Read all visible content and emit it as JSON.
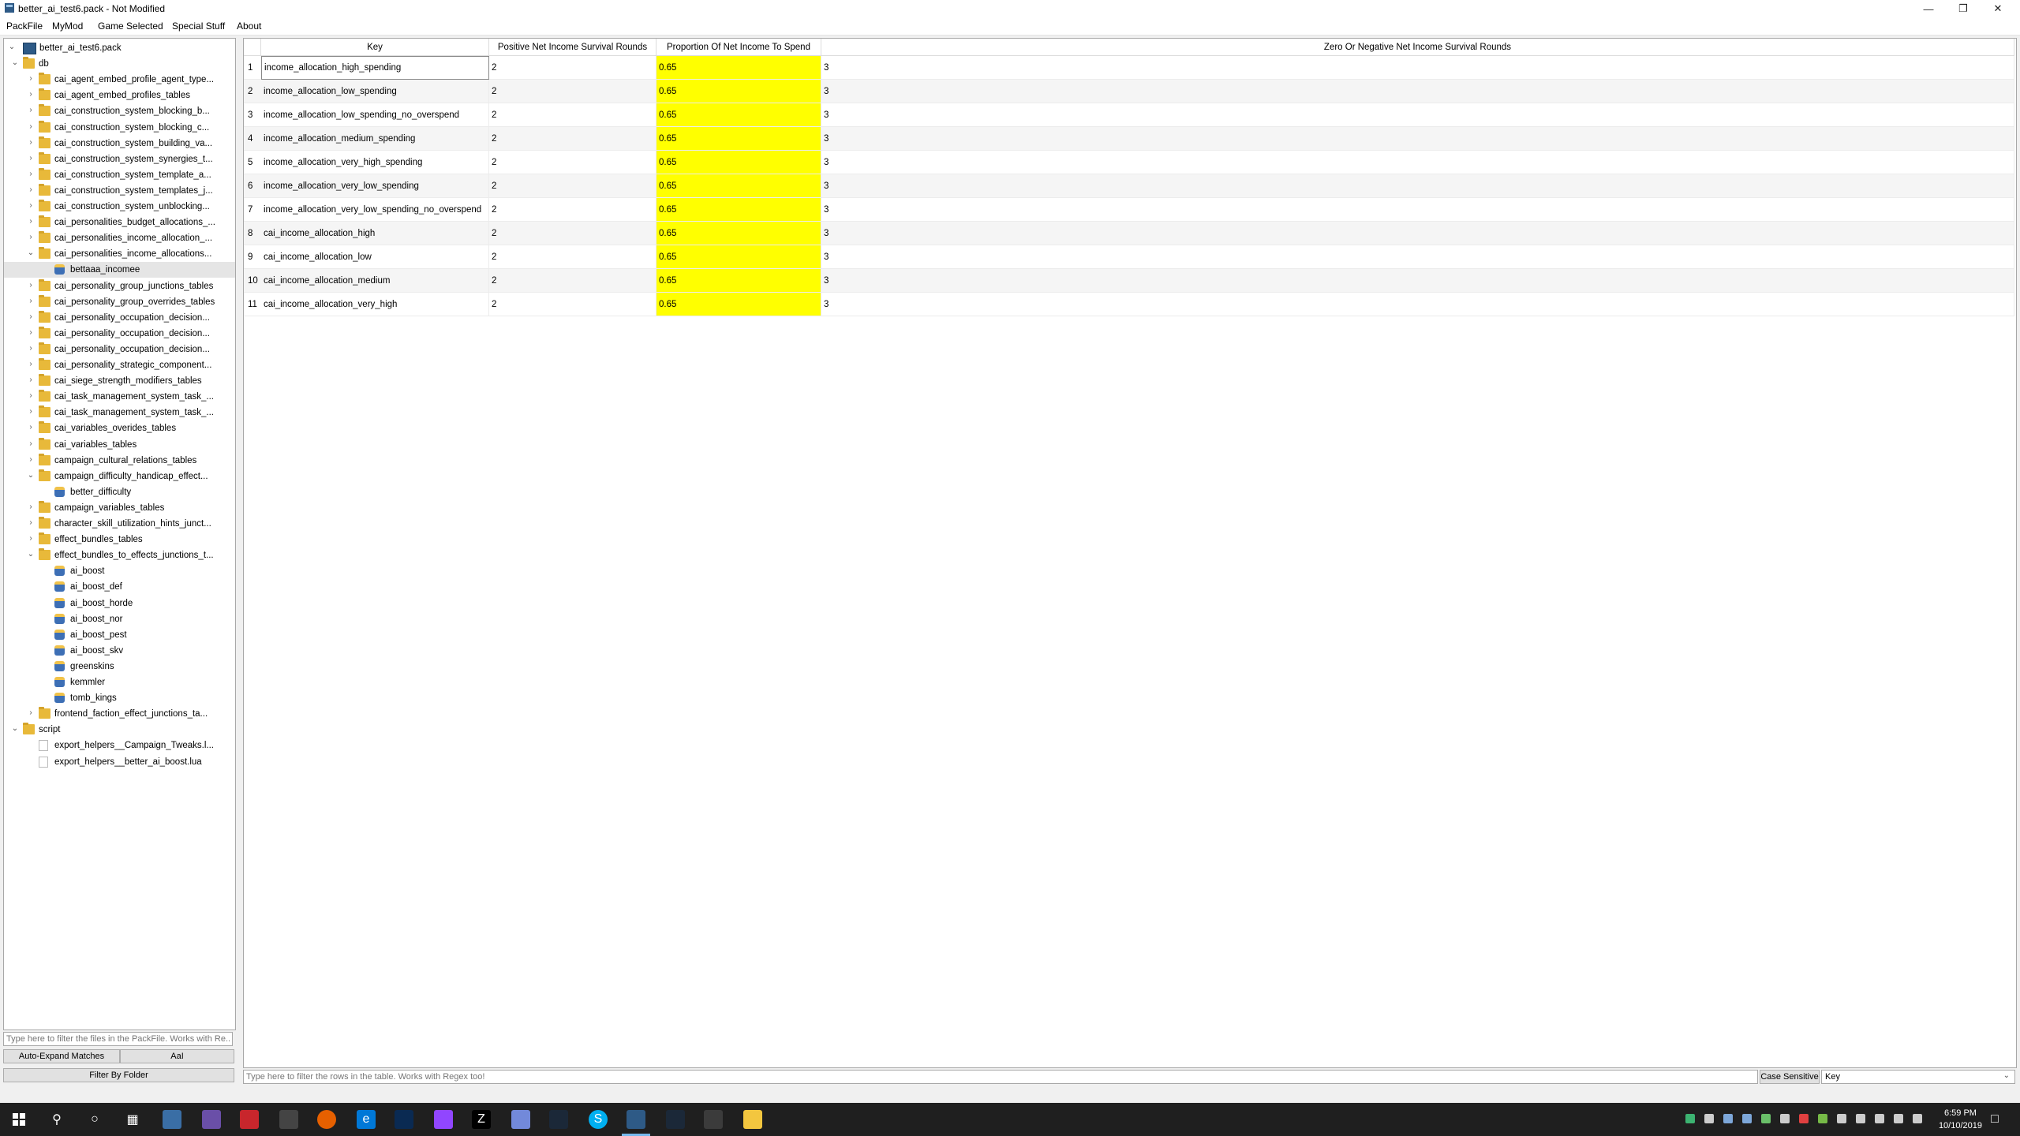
{
  "window": {
    "title": "better_ai_test6.pack - Not Modified"
  },
  "menu": [
    "PackFile",
    "MyMod",
    "Game Selected",
    "Special Stuff",
    "About"
  ],
  "tree": {
    "root": "better_ai_test6.pack",
    "items": [
      {
        "label": "db",
        "kind": "folder",
        "depth": 1,
        "expanded": true
      },
      {
        "label": "cai_agent_embed_profile_agent_type...",
        "kind": "folder",
        "depth": 2
      },
      {
        "label": "cai_agent_embed_profiles_tables",
        "kind": "folder",
        "depth": 2
      },
      {
        "label": "cai_construction_system_blocking_b...",
        "kind": "folder",
        "depth": 2
      },
      {
        "label": "cai_construction_system_blocking_c...",
        "kind": "folder",
        "depth": 2
      },
      {
        "label": "cai_construction_system_building_va...",
        "kind": "folder",
        "depth": 2
      },
      {
        "label": "cai_construction_system_synergies_t...",
        "kind": "folder",
        "depth": 2
      },
      {
        "label": "cai_construction_system_template_a...",
        "kind": "folder",
        "depth": 2
      },
      {
        "label": "cai_construction_system_templates_j...",
        "kind": "folder",
        "depth": 2
      },
      {
        "label": "cai_construction_system_unblocking...",
        "kind": "folder",
        "depth": 2
      },
      {
        "label": "cai_personalities_budget_allocations_...",
        "kind": "folder",
        "depth": 2
      },
      {
        "label": "cai_personalities_income_allocation_...",
        "kind": "folder",
        "depth": 2
      },
      {
        "label": "cai_personalities_income_allocations...",
        "kind": "folder",
        "depth": 2,
        "expanded": true
      },
      {
        "label": "bettaaa_incomee",
        "kind": "db",
        "depth": 3,
        "selected": true
      },
      {
        "label": "cai_personality_group_junctions_tables",
        "kind": "folder",
        "depth": 2
      },
      {
        "label": "cai_personality_group_overrides_tables",
        "kind": "folder",
        "depth": 2
      },
      {
        "label": "cai_personality_occupation_decision...",
        "kind": "folder",
        "depth": 2
      },
      {
        "label": "cai_personality_occupation_decision...",
        "kind": "folder",
        "depth": 2
      },
      {
        "label": "cai_personality_occupation_decision...",
        "kind": "folder",
        "depth": 2
      },
      {
        "label": "cai_personality_strategic_component...",
        "kind": "folder",
        "depth": 2
      },
      {
        "label": "cai_siege_strength_modifiers_tables",
        "kind": "folder",
        "depth": 2
      },
      {
        "label": "cai_task_management_system_task_...",
        "kind": "folder",
        "depth": 2
      },
      {
        "label": "cai_task_management_system_task_...",
        "kind": "folder",
        "depth": 2
      },
      {
        "label": "cai_variables_overides_tables",
        "kind": "folder",
        "depth": 2
      },
      {
        "label": "cai_variables_tables",
        "kind": "folder",
        "depth": 2
      },
      {
        "label": "campaign_cultural_relations_tables",
        "kind": "folder",
        "depth": 2
      },
      {
        "label": "campaign_difficulty_handicap_effect...",
        "kind": "folder",
        "depth": 2,
        "expanded": true
      },
      {
        "label": "better_difficulty",
        "kind": "db",
        "depth": 3
      },
      {
        "label": "campaign_variables_tables",
        "kind": "folder",
        "depth": 2
      },
      {
        "label": "character_skill_utilization_hints_junct...",
        "kind": "folder",
        "depth": 2
      },
      {
        "label": "effect_bundles_tables",
        "kind": "folder",
        "depth": 2
      },
      {
        "label": "effect_bundles_to_effects_junctions_t...",
        "kind": "folder",
        "depth": 2,
        "expanded": true
      },
      {
        "label": "ai_boost",
        "kind": "db",
        "depth": 3
      },
      {
        "label": "ai_boost_def",
        "kind": "db",
        "depth": 3
      },
      {
        "label": "ai_boost_horde",
        "kind": "db",
        "depth": 3
      },
      {
        "label": "ai_boost_nor",
        "kind": "db",
        "depth": 3
      },
      {
        "label": "ai_boost_pest",
        "kind": "db",
        "depth": 3
      },
      {
        "label": "ai_boost_skv",
        "kind": "db",
        "depth": 3
      },
      {
        "label": "greenskins",
        "kind": "db",
        "depth": 3
      },
      {
        "label": "kemmler",
        "kind": "db",
        "depth": 3
      },
      {
        "label": "tomb_kings",
        "kind": "db",
        "depth": 3
      },
      {
        "label": "frontend_faction_effect_junctions_ta...",
        "kind": "folder",
        "depth": 2
      },
      {
        "label": "script",
        "kind": "folder",
        "depth": 1,
        "expanded": true
      },
      {
        "label": "export_helpers__Campaign_Tweaks.l...",
        "kind": "file",
        "depth": 2
      },
      {
        "label": "export_helpers__better_ai_boost.lua",
        "kind": "file",
        "depth": 2
      }
    ]
  },
  "tree_filter": {
    "placeholder": "Type here to filter the files in the PackFile. Works with Re..."
  },
  "buttons": {
    "auto_expand": "Auto-Expand Matches",
    "case": "AaI",
    "filter_folder": "Filter By Folder"
  },
  "table": {
    "columns": [
      "Key",
      "Positive Net Income Survival Rounds",
      "Proportion Of Net Income To Spend",
      "Zero Or Negative Net Income Survival Rounds"
    ],
    "rows": [
      {
        "n": "1",
        "key": "income_allocation_high_spending",
        "pos": "2",
        "prop": "0.65",
        "zero": "3"
      },
      {
        "n": "2",
        "key": "income_allocation_low_spending",
        "pos": "2",
        "prop": "0.65",
        "zero": "3"
      },
      {
        "n": "3",
        "key": "income_allocation_low_spending_no_overspend",
        "pos": "2",
        "prop": "0.65",
        "zero": "3"
      },
      {
        "n": "4",
        "key": "income_allocation_medium_spending",
        "pos": "2",
        "prop": "0.65",
        "zero": "3"
      },
      {
        "n": "5",
        "key": "income_allocation_very_high_spending",
        "pos": "2",
        "prop": "0.65",
        "zero": "3"
      },
      {
        "n": "6",
        "key": "income_allocation_very_low_spending",
        "pos": "2",
        "prop": "0.65",
        "zero": "3"
      },
      {
        "n": "7",
        "key": "income_allocation_very_low_spending_no_overspend",
        "pos": "2",
        "prop": "0.65",
        "zero": "3"
      },
      {
        "n": "8",
        "key": "cai_income_allocation_high",
        "pos": "2",
        "prop": "0.65",
        "zero": "3"
      },
      {
        "n": "9",
        "key": "cai_income_allocation_low",
        "pos": "2",
        "prop": "0.65",
        "zero": "3"
      },
      {
        "n": "10",
        "key": "cai_income_allocation_medium",
        "pos": "2",
        "prop": "0.65",
        "zero": "3"
      },
      {
        "n": "11",
        "key": "cai_income_allocation_very_high",
        "pos": "2",
        "prop": "0.65",
        "zero": "3"
      }
    ],
    "highlight_color": "#ffff00"
  },
  "row_filter": {
    "placeholder": "Type here to filter the rows in the table. Works with Regex too!",
    "case_label": "Case Sensitive",
    "column_selected": "Key"
  },
  "taskbar": {
    "time": "6:59 PM",
    "date": "10/10/2019"
  }
}
